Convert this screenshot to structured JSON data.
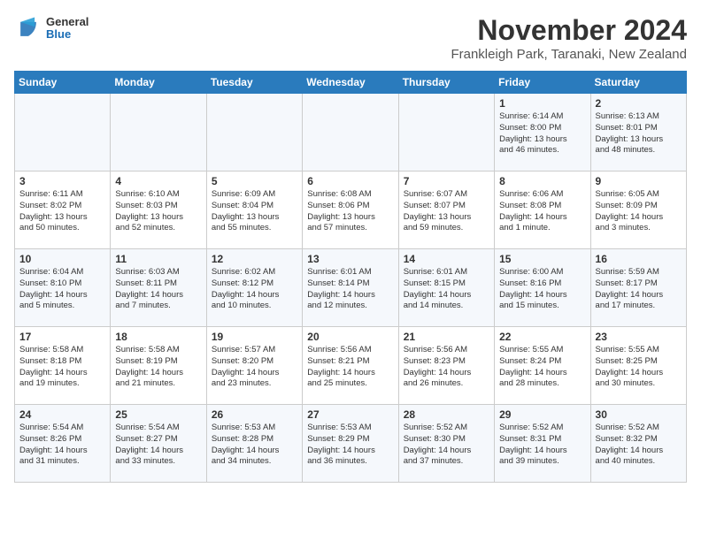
{
  "logo": {
    "general": "General",
    "blue": "Blue"
  },
  "title": "November 2024",
  "subtitle": "Frankleigh Park, Taranaki, New Zealand",
  "days_of_week": [
    "Sunday",
    "Monday",
    "Tuesday",
    "Wednesday",
    "Thursday",
    "Friday",
    "Saturday"
  ],
  "weeks": [
    [
      {
        "day": "",
        "info": ""
      },
      {
        "day": "",
        "info": ""
      },
      {
        "day": "",
        "info": ""
      },
      {
        "day": "",
        "info": ""
      },
      {
        "day": "",
        "info": ""
      },
      {
        "day": "1",
        "info": "Sunrise: 6:14 AM\nSunset: 8:00 PM\nDaylight: 13 hours\nand 46 minutes."
      },
      {
        "day": "2",
        "info": "Sunrise: 6:13 AM\nSunset: 8:01 PM\nDaylight: 13 hours\nand 48 minutes."
      }
    ],
    [
      {
        "day": "3",
        "info": "Sunrise: 6:11 AM\nSunset: 8:02 PM\nDaylight: 13 hours\nand 50 minutes."
      },
      {
        "day": "4",
        "info": "Sunrise: 6:10 AM\nSunset: 8:03 PM\nDaylight: 13 hours\nand 52 minutes."
      },
      {
        "day": "5",
        "info": "Sunrise: 6:09 AM\nSunset: 8:04 PM\nDaylight: 13 hours\nand 55 minutes."
      },
      {
        "day": "6",
        "info": "Sunrise: 6:08 AM\nSunset: 8:06 PM\nDaylight: 13 hours\nand 57 minutes."
      },
      {
        "day": "7",
        "info": "Sunrise: 6:07 AM\nSunset: 8:07 PM\nDaylight: 13 hours\nand 59 minutes."
      },
      {
        "day": "8",
        "info": "Sunrise: 6:06 AM\nSunset: 8:08 PM\nDaylight: 14 hours\nand 1 minute."
      },
      {
        "day": "9",
        "info": "Sunrise: 6:05 AM\nSunset: 8:09 PM\nDaylight: 14 hours\nand 3 minutes."
      }
    ],
    [
      {
        "day": "10",
        "info": "Sunrise: 6:04 AM\nSunset: 8:10 PM\nDaylight: 14 hours\nand 5 minutes."
      },
      {
        "day": "11",
        "info": "Sunrise: 6:03 AM\nSunset: 8:11 PM\nDaylight: 14 hours\nand 7 minutes."
      },
      {
        "day": "12",
        "info": "Sunrise: 6:02 AM\nSunset: 8:12 PM\nDaylight: 14 hours\nand 10 minutes."
      },
      {
        "day": "13",
        "info": "Sunrise: 6:01 AM\nSunset: 8:14 PM\nDaylight: 14 hours\nand 12 minutes."
      },
      {
        "day": "14",
        "info": "Sunrise: 6:01 AM\nSunset: 8:15 PM\nDaylight: 14 hours\nand 14 minutes."
      },
      {
        "day": "15",
        "info": "Sunrise: 6:00 AM\nSunset: 8:16 PM\nDaylight: 14 hours\nand 15 minutes."
      },
      {
        "day": "16",
        "info": "Sunrise: 5:59 AM\nSunset: 8:17 PM\nDaylight: 14 hours\nand 17 minutes."
      }
    ],
    [
      {
        "day": "17",
        "info": "Sunrise: 5:58 AM\nSunset: 8:18 PM\nDaylight: 14 hours\nand 19 minutes."
      },
      {
        "day": "18",
        "info": "Sunrise: 5:58 AM\nSunset: 8:19 PM\nDaylight: 14 hours\nand 21 minutes."
      },
      {
        "day": "19",
        "info": "Sunrise: 5:57 AM\nSunset: 8:20 PM\nDaylight: 14 hours\nand 23 minutes."
      },
      {
        "day": "20",
        "info": "Sunrise: 5:56 AM\nSunset: 8:21 PM\nDaylight: 14 hours\nand 25 minutes."
      },
      {
        "day": "21",
        "info": "Sunrise: 5:56 AM\nSunset: 8:23 PM\nDaylight: 14 hours\nand 26 minutes."
      },
      {
        "day": "22",
        "info": "Sunrise: 5:55 AM\nSunset: 8:24 PM\nDaylight: 14 hours\nand 28 minutes."
      },
      {
        "day": "23",
        "info": "Sunrise: 5:55 AM\nSunset: 8:25 PM\nDaylight: 14 hours\nand 30 minutes."
      }
    ],
    [
      {
        "day": "24",
        "info": "Sunrise: 5:54 AM\nSunset: 8:26 PM\nDaylight: 14 hours\nand 31 minutes."
      },
      {
        "day": "25",
        "info": "Sunrise: 5:54 AM\nSunset: 8:27 PM\nDaylight: 14 hours\nand 33 minutes."
      },
      {
        "day": "26",
        "info": "Sunrise: 5:53 AM\nSunset: 8:28 PM\nDaylight: 14 hours\nand 34 minutes."
      },
      {
        "day": "27",
        "info": "Sunrise: 5:53 AM\nSunset: 8:29 PM\nDaylight: 14 hours\nand 36 minutes."
      },
      {
        "day": "28",
        "info": "Sunrise: 5:52 AM\nSunset: 8:30 PM\nDaylight: 14 hours\nand 37 minutes."
      },
      {
        "day": "29",
        "info": "Sunrise: 5:52 AM\nSunset: 8:31 PM\nDaylight: 14 hours\nand 39 minutes."
      },
      {
        "day": "30",
        "info": "Sunrise: 5:52 AM\nSunset: 8:32 PM\nDaylight: 14 hours\nand 40 minutes."
      }
    ]
  ]
}
